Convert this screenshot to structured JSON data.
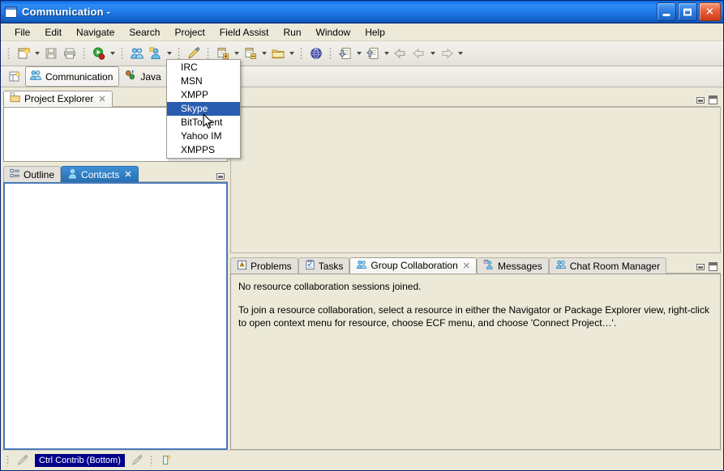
{
  "window": {
    "title": "Communication -",
    "icon": "window-icon",
    "controls": {
      "minimize": "_",
      "maximize": "□",
      "close": "✕"
    }
  },
  "menubar": {
    "items": [
      {
        "label": "File"
      },
      {
        "label": "Edit"
      },
      {
        "label": "Navigate"
      },
      {
        "label": "Search"
      },
      {
        "label": "Project"
      },
      {
        "label": "Field Assist"
      },
      {
        "label": "Run"
      },
      {
        "label": "Window"
      },
      {
        "label": "Help"
      }
    ]
  },
  "toolbar": {
    "items": [
      {
        "icon": "new-file-icon",
        "dropdown": true
      },
      {
        "icon": "save-icon",
        "dropdown": false
      },
      {
        "icon": "print-icon",
        "dropdown": false
      },
      {
        "icon": "run-icon",
        "dropdown": true
      },
      {
        "icon": "group-users-icon",
        "dropdown": false
      },
      {
        "icon": "user-connect-icon",
        "dropdown": true
      },
      {
        "icon": "pencil-icon",
        "dropdown": false
      },
      {
        "icon": "new-file-add-icon",
        "dropdown": true
      },
      {
        "icon": "new-folder-file-icon",
        "dropdown": true
      },
      {
        "icon": "new-folder-icon",
        "dropdown": true
      },
      {
        "icon": "globe-icon",
        "dropdown": false
      },
      {
        "icon": "import-icon",
        "dropdown": true
      },
      {
        "icon": "export-icon",
        "dropdown": true
      },
      {
        "icon": "back-left-icon",
        "dropdown": false
      },
      {
        "icon": "previous-arrow-icon",
        "dropdown": true
      },
      {
        "icon": "next-arrow-icon",
        "dropdown": true
      }
    ]
  },
  "perspective_bar": {
    "open_perspective_icon": "open-perspective-icon",
    "items": [
      {
        "label": "Communication",
        "icon": "communication-perspective-icon",
        "active": true
      },
      {
        "label": "Java",
        "icon": "java-perspective-icon",
        "active": false
      }
    ]
  },
  "dropdown_menu": {
    "items": [
      {
        "label": "IRC",
        "selected": false
      },
      {
        "label": "MSN",
        "selected": false
      },
      {
        "label": "XMPP",
        "selected": false
      },
      {
        "label": "Skype",
        "selected": true
      },
      {
        "label": "BitTorrent",
        "selected": false
      },
      {
        "label": "Yahoo IM",
        "selected": false
      },
      {
        "label": "XMPPS",
        "selected": false
      }
    ]
  },
  "project_explorer": {
    "tab_label": "Project Explorer",
    "tab_icon": "project-explorer-icon",
    "close_label": "✕",
    "content": ""
  },
  "contacts_pane": {
    "tabs": [
      {
        "label": "Outline",
        "icon": "outline-icon",
        "active": false,
        "closable": false
      },
      {
        "label": "Contacts",
        "icon": "contacts-icon",
        "active": true,
        "closable": true
      }
    ],
    "close_label": "✕",
    "content": ""
  },
  "editor_area": {
    "content": ""
  },
  "bottom_pane": {
    "tabs": [
      {
        "label": "Problems",
        "icon": "problems-icon",
        "active": false,
        "closable": false
      },
      {
        "label": "Tasks",
        "icon": "tasks-icon",
        "active": false,
        "closable": false
      },
      {
        "label": "Group Collaboration",
        "icon": "group-collaboration-icon",
        "active": true,
        "closable": true
      },
      {
        "label": "Messages",
        "icon": "messages-icon",
        "active": false,
        "closable": false
      },
      {
        "label": "Chat Room Manager",
        "icon": "chat-room-manager-icon",
        "active": false,
        "closable": false
      }
    ],
    "close_label": "✕",
    "body": {
      "line1": "No resource collaboration sessions joined.",
      "line2": "To join a resource collaboration, select a resource in either the Navigator or Package Explorer view, right-click to open context menu for resource, choose ECF menu, and choose 'Connect Project…'."
    }
  },
  "statusbar": {
    "items": [
      {
        "icon": "pencil-disabled-icon"
      },
      {
        "label": "Ctrl Contrib (Bottom)",
        "highlight": true
      },
      {
        "icon": "pencil-disabled-icon-2"
      },
      {
        "icon": "insert-mode-icon"
      }
    ]
  },
  "colors": {
    "title_blue": "#1f7ae8",
    "menu_select_blue": "#2a5db0",
    "tab_active_blue": "#2f7ec4",
    "status_chip_bg": "#00008b",
    "chrome": "#ece9d8"
  }
}
